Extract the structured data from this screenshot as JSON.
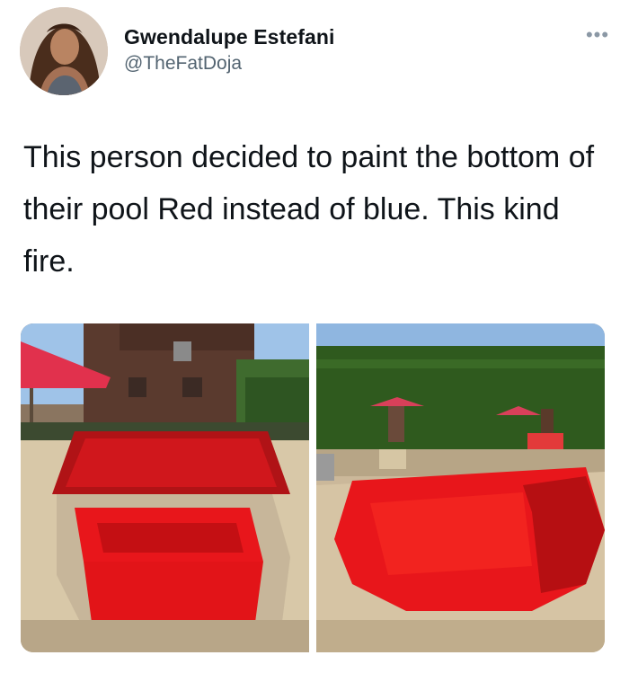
{
  "tweet": {
    "author": {
      "display_name": "Gwendalupe Estefani",
      "handle": "@TheFatDoja",
      "avatar_icon": "profile-photo"
    },
    "more_icon": "more-horizontal-icon",
    "text": "This person decided to paint the bottom of their pool Red instead of blue. This kind fire.",
    "media": [
      {
        "icon": "photo-red-pool-mansion"
      },
      {
        "icon": "photo-red-pool-garden"
      }
    ],
    "colors": {
      "text": "#0f1419",
      "secondary": "#536471",
      "pool_red": "#e8161b"
    }
  }
}
